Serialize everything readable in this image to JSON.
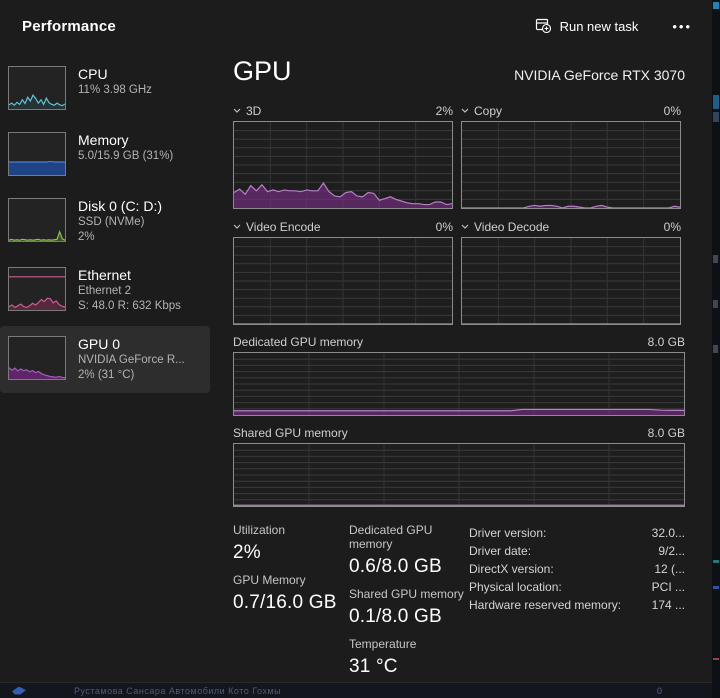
{
  "header": {
    "title": "Performance",
    "run_new_task": "Run new task",
    "more_label": "•••"
  },
  "sidebar": {
    "items": [
      {
        "id": "cpu",
        "title": "CPU",
        "line2": "11%  3.98 GHz"
      },
      {
        "id": "memory",
        "title": "Memory",
        "line2": "5.0/15.9 GB (31%)"
      },
      {
        "id": "disk",
        "title": "Disk 0 (C: D:)",
        "line2": "SSD (NVMe)",
        "line3": "2%"
      },
      {
        "id": "ethernet",
        "title": "Ethernet",
        "line2": "Ethernet 2",
        "line3": "S: 48.0 R: 632 Kbps"
      },
      {
        "id": "gpu",
        "title": "GPU 0",
        "line2": "NVIDIA GeForce R...",
        "line3": "2%  (31 °C)",
        "selected": true
      }
    ]
  },
  "main": {
    "title": "GPU",
    "subtitle": "NVIDIA GeForce RTX 3070",
    "charts": [
      {
        "label": "3D",
        "value": "2%"
      },
      {
        "label": "Copy",
        "value": "0%"
      },
      {
        "label": "Video Encode",
        "value": "0%"
      },
      {
        "label": "Video Decode",
        "value": "0%"
      }
    ],
    "memory": [
      {
        "label": "Dedicated GPU memory",
        "max": "8.0 GB"
      },
      {
        "label": "Shared GPU memory",
        "max": "8.0 GB"
      }
    ],
    "stats": [
      {
        "label": "Utilization",
        "value": "2%"
      },
      {
        "label": "GPU Memory",
        "value": "0.7/16.0 GB"
      },
      {
        "label": "Dedicated GPU memory",
        "value": "0.6/8.0 GB"
      },
      {
        "label": "Shared GPU memory",
        "value": "0.1/8.0 GB"
      },
      {
        "label": "Temperature",
        "value": "31 °C"
      }
    ],
    "details": [
      {
        "label": "Driver version:",
        "value": "32.0..."
      },
      {
        "label": "Driver date:",
        "value": "9/2..."
      },
      {
        "label": "DirectX version:",
        "value": "12 (..."
      },
      {
        "label": "Physical location:",
        "value": "PCI ..."
      },
      {
        "label": "Hardware reserved memory:",
        "value": "174 ..."
      }
    ]
  },
  "background": {
    "bottom_text": "Рустамова Сансара Автомобили Кото Гохмы",
    "badge": "0"
  },
  "colors": {
    "accent_purple_line": "#b87fc8",
    "accent_purple_fill": "rgba(125,45,140,0.6)",
    "cpu_cyan": "#5fc4d4",
    "memory_blue": "#3f6cb4",
    "disk_green": "#8bc34a",
    "ethernet_pink": "#c75e93",
    "selected_row_bg": "#2d2d2d",
    "window_bg": "#1c1c1c",
    "chart_border": "#8c8c8c",
    "grid_line": "#3a3a3a"
  },
  "chart_data": {
    "gpu_3d": {
      "type": "area",
      "title": "3D",
      "current": "2%",
      "ymax": 100,
      "grid": true,
      "line": "#b87fc8",
      "fill": "rgba(125,45,140,0.6)",
      "values": [
        18,
        22,
        16,
        26,
        20,
        27,
        19,
        21,
        19,
        21,
        20,
        20,
        19,
        21,
        20,
        20,
        29,
        19,
        14,
        13,
        18,
        19,
        14,
        13,
        18,
        17,
        9,
        11,
        13,
        10,
        8,
        6,
        5,
        5,
        4,
        4,
        7,
        7,
        4,
        5
      ]
    },
    "gpu_copy": {
      "type": "area",
      "title": "Copy",
      "current": "0%",
      "ymax": 100,
      "grid": true,
      "line": "#b87fc8",
      "fill": "rgba(125,45,140,0.6)",
      "values": [
        0,
        0,
        0,
        0,
        0,
        0,
        0,
        0,
        0,
        0,
        0,
        0,
        2,
        3,
        2,
        3,
        3,
        2,
        0,
        2,
        2,
        1,
        0,
        0,
        2,
        3,
        1,
        0,
        0,
        0,
        0,
        0,
        0,
        0,
        0,
        0,
        0,
        0,
        2,
        1
      ]
    },
    "video_encode": {
      "type": "area",
      "title": "Video Encode",
      "current": "0%",
      "ymax": 100,
      "grid": true,
      "line": "#b87fc8",
      "fill": "rgba(125,45,140,0.6)",
      "values": [
        0,
        0,
        0,
        0,
        0,
        0,
        0,
        0,
        0,
        0,
        0,
        0,
        0,
        0,
        0,
        0,
        0,
        0,
        0,
        0,
        0,
        0,
        0,
        0,
        0,
        0,
        0,
        0,
        0,
        0,
        0,
        0,
        0,
        0,
        0,
        0,
        0,
        0,
        0,
        0
      ]
    },
    "video_decode": {
      "type": "area",
      "title": "Video Decode",
      "current": "0%",
      "ymax": 100,
      "grid": true,
      "line": "#b87fc8",
      "fill": "rgba(125,45,140,0.6)",
      "values": [
        0,
        0,
        0,
        0,
        0,
        0,
        0,
        0,
        0,
        0,
        0,
        0,
        0,
        0,
        0,
        0,
        0,
        0,
        0,
        0,
        0,
        0,
        0,
        0,
        0,
        0,
        0,
        0,
        0,
        0,
        0,
        0,
        0,
        0,
        0,
        0,
        0,
        0,
        0,
        0
      ]
    },
    "dedicated_memory": {
      "type": "area",
      "title": "Dedicated GPU memory",
      "unit": "GB",
      "ymax": 8,
      "grid": true,
      "line": "#b87fc8",
      "fill": "rgba(125,45,140,0.6)",
      "values": [
        0.55,
        0.55,
        0.55,
        0.55,
        0.55,
        0.55,
        0.55,
        0.55,
        0.55,
        0.55,
        0.55,
        0.55,
        0.55,
        0.55,
        0.55,
        0.55,
        0.55,
        0.55,
        0.55,
        0.55,
        0.55,
        0.55,
        0.55,
        0.55,
        0.55,
        0.72,
        0.72,
        0.72,
        0.72,
        0.72,
        0.72,
        0.72,
        0.72,
        0.72,
        0.72,
        0.72,
        0.72,
        0.62,
        0.6,
        0.6
      ]
    },
    "shared_memory": {
      "type": "area",
      "title": "Shared GPU memory",
      "unit": "GB",
      "ymax": 8,
      "grid": true,
      "line": "#b87fc8",
      "fill": "rgba(125,45,140,0.6)",
      "values": [
        0.1,
        0.1,
        0.1,
        0.1,
        0.1,
        0.1,
        0.1,
        0.1,
        0.1,
        0.1,
        0.1,
        0.1,
        0.1,
        0.1,
        0.1,
        0.1,
        0.1,
        0.1,
        0.1,
        0.1,
        0.1,
        0.1,
        0.1,
        0.1,
        0.1,
        0.1,
        0.1,
        0.1,
        0.1,
        0.1,
        0.1,
        0.1,
        0.1,
        0.1,
        0.1,
        0.1,
        0.1,
        0.1,
        0.1,
        0.1
      ]
    },
    "cpu_thumb": {
      "type": "line",
      "ymax": 100,
      "line": "#5fc4d4",
      "fill": "rgba(60,150,165,0.15)",
      "values": [
        10,
        14,
        9,
        16,
        11,
        22,
        13,
        28,
        19,
        33,
        25,
        14,
        22,
        11,
        26,
        15,
        11,
        9,
        14,
        10,
        8,
        12
      ]
    },
    "memory_thumb": {
      "type": "area",
      "ymax": 100,
      "line": "#4a7ed0",
      "fill": "rgba(33,70,140,0.95)",
      "values": [
        31,
        31,
        31,
        31,
        31,
        31,
        31,
        31,
        31,
        31,
        31,
        31,
        31,
        31,
        31,
        32,
        32,
        31,
        31,
        31,
        31,
        31
      ]
    },
    "disk_thumb": {
      "type": "area",
      "ymax": 100,
      "line": "#8bc34a",
      "fill": "rgba(120,180,60,0.3)",
      "values": [
        2,
        4,
        2,
        3,
        2,
        4,
        3,
        2,
        3,
        2,
        3,
        4,
        2,
        3,
        2,
        3,
        2,
        3,
        4,
        22,
        5,
        2
      ]
    },
    "ethernet_thumb": {
      "type": "area",
      "ymax": 100,
      "line": "#c75e93",
      "fill": "rgba(160,50,100,0.4)",
      "hline": 79,
      "hline_color": "#c75e93",
      "values": [
        8,
        12,
        6,
        10,
        14,
        8,
        6,
        10,
        16,
        12,
        18,
        25,
        20,
        28,
        27,
        17,
        22,
        13,
        9,
        7
      ]
    },
    "gpu_thumb": {
      "type": "area",
      "ymax": 100,
      "line": "#a35cb8",
      "fill": "rgba(120,40,135,0.7)",
      "values": [
        27,
        21,
        26,
        19,
        24,
        20,
        22,
        17,
        20,
        15,
        18,
        13,
        10,
        8,
        6,
        5,
        4,
        6,
        4,
        3
      ]
    }
  }
}
